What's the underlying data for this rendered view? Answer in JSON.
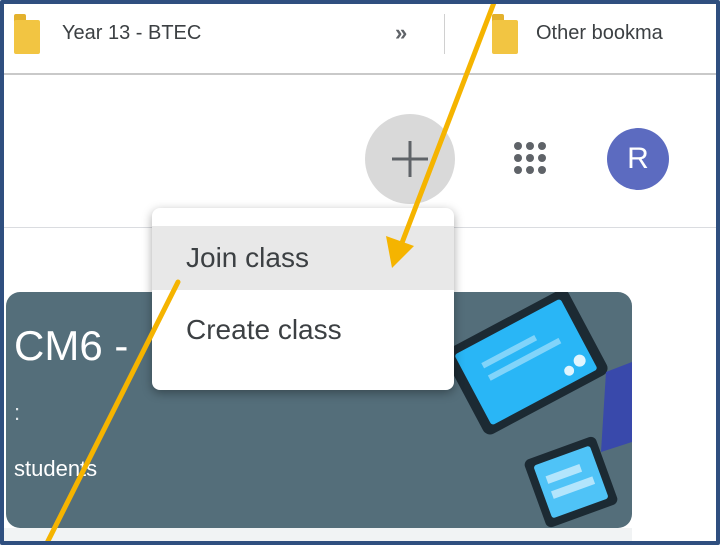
{
  "bookmarks_bar": {
    "folder1_label": "Year 13 - BTEC",
    "more_glyph": "»",
    "folder2_label": "Other bookma"
  },
  "header": {
    "avatar_initial": "R",
    "create_or_join_icon": "plus-icon",
    "apps_icon": "apps-grid-icon"
  },
  "menu": {
    "items": [
      {
        "label": "Join class"
      },
      {
        "label": "Create class"
      }
    ]
  },
  "class_card": {
    "title": "CM6 -",
    "subtitle": ":",
    "students": "students"
  },
  "colors": {
    "annotation_arrow": "#f5b400",
    "avatar": "#5c6bc0",
    "card_background": "#546e7a",
    "folder": "#f2c542"
  }
}
